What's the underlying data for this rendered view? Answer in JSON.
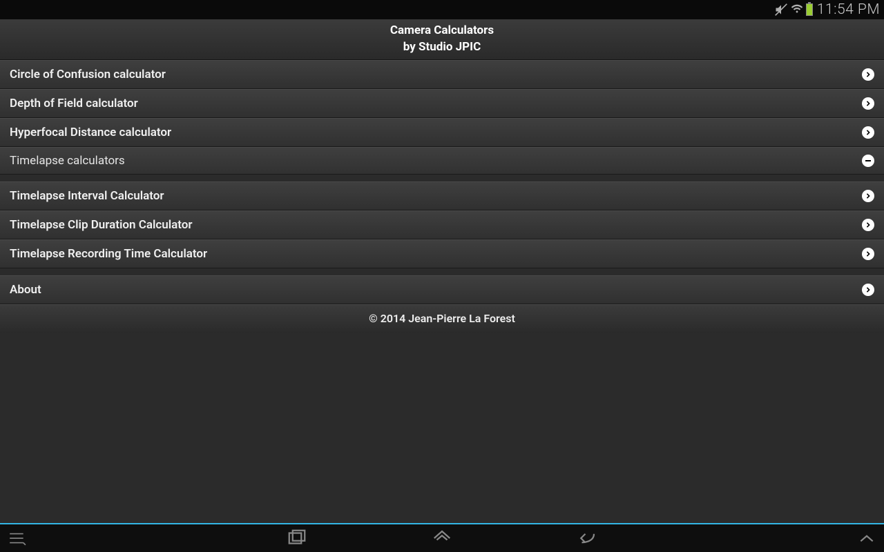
{
  "statusbar": {
    "time": "11:54 PM"
  },
  "header": {
    "title": "Camera Calculators",
    "subtitle": "by Studio JPIC"
  },
  "items": [
    {
      "label": "Circle of Confusion calculator"
    },
    {
      "label": "Depth of Field calculator"
    },
    {
      "label": "Hyperfocal Distance calculator"
    }
  ],
  "group": {
    "label": "Timelapse calculators"
  },
  "subitems": [
    {
      "label": "Timelapse Interval Calculator"
    },
    {
      "label": "Timelapse Clip Duration Calculator"
    },
    {
      "label": "Timelapse Recording Time Calculator"
    }
  ],
  "about": {
    "label": "About"
  },
  "footer": {
    "copyright": "© 2014 Jean-Pierre La Forest"
  }
}
